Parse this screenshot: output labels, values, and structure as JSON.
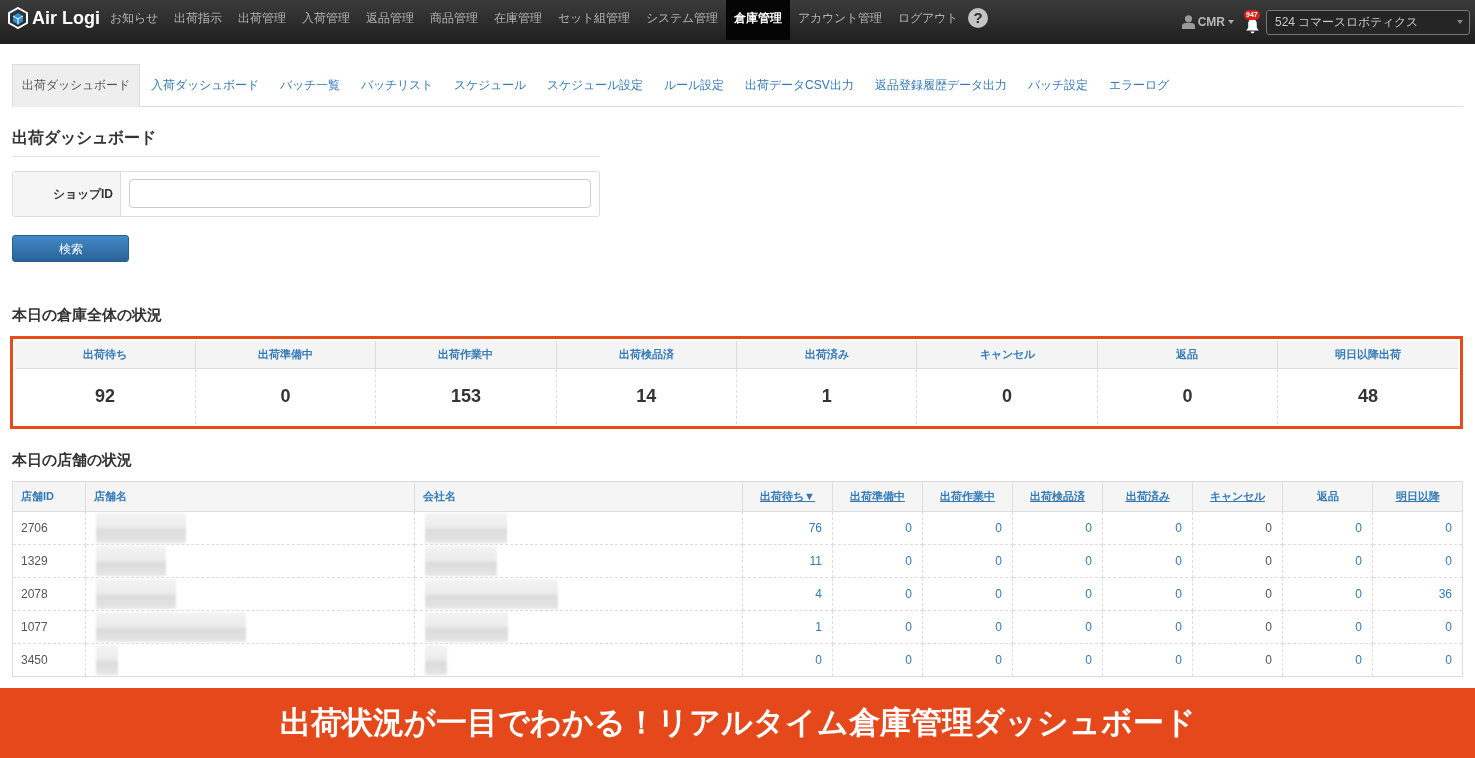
{
  "navbar": {
    "logo": "Air Logi",
    "menu": [
      {
        "label": "お知らせ",
        "selected": false
      },
      {
        "label": "出荷指示",
        "selected": false
      },
      {
        "label": "出荷管理",
        "selected": false
      },
      {
        "label": "入荷管理",
        "selected": false
      },
      {
        "label": "返品管理",
        "selected": false
      },
      {
        "label": "商品管理",
        "selected": false
      },
      {
        "label": "在庫管理",
        "selected": false
      },
      {
        "label": "セット組管理",
        "selected": false
      },
      {
        "label": "システム管理",
        "selected": false
      },
      {
        "label": "倉庫管理",
        "selected": true
      },
      {
        "label": "アカウント管理",
        "selected": false
      },
      {
        "label": "ログアウト",
        "selected": false
      }
    ],
    "help": "?",
    "user": "CMR",
    "notification_count": "947",
    "warehouse_select": "524 コマースロボティクス"
  },
  "tabs": [
    {
      "label": "出荷ダッシュボード",
      "selected": true
    },
    {
      "label": "入荷ダッシュボード",
      "selected": false
    },
    {
      "label": "バッチ一覧",
      "selected": false
    },
    {
      "label": "バッチリスト",
      "selected": false
    },
    {
      "label": "スケジュール",
      "selected": false
    },
    {
      "label": "スケジュール設定",
      "selected": false
    },
    {
      "label": "ルール設定",
      "selected": false
    },
    {
      "label": "出荷データCSV出力",
      "selected": false
    },
    {
      "label": "返品登録履歴データ出力",
      "selected": false
    },
    {
      "label": "バッチ設定",
      "selected": false
    },
    {
      "label": "エラーログ",
      "selected": false
    }
  ],
  "page_title": "出荷ダッシュボード",
  "search_form": {
    "label": "ショップID",
    "button": "検索"
  },
  "warehouse_status": {
    "title": "本日の倉庫全体の状況",
    "highlighted": true,
    "items": [
      {
        "label": "出荷待ち",
        "value": "92"
      },
      {
        "label": "出荷準備中",
        "value": "0"
      },
      {
        "label": "出荷作業中",
        "value": "153"
      },
      {
        "label": "出荷検品済",
        "value": "14"
      },
      {
        "label": "出荷済み",
        "value": "1"
      },
      {
        "label": "キャンセル",
        "value": "0"
      },
      {
        "label": "返品",
        "value": "0"
      },
      {
        "label": "明日以降出荷",
        "value": "48"
      }
    ]
  },
  "store_status": {
    "title": "本日の店舗の状況",
    "columns": [
      {
        "label": "店舗ID",
        "kind": "id",
        "sortable": false
      },
      {
        "label": "店舗名",
        "kind": "redacted",
        "sortable": false
      },
      {
        "label": "会社名",
        "kind": "redacted",
        "sortable": false
      },
      {
        "label": "出荷待ち▼",
        "kind": "link_count",
        "sortable": true
      },
      {
        "label": "出荷準備中",
        "kind": "link_count",
        "sortable": true
      },
      {
        "label": "出荷作業中",
        "kind": "link_count",
        "sortable": true
      },
      {
        "label": "出荷検品済",
        "kind": "link_count",
        "sortable": true
      },
      {
        "label": "出荷済み",
        "kind": "link_count",
        "sortable": true
      },
      {
        "label": "キャンセル",
        "kind": "count",
        "sortable": true
      },
      {
        "label": "返品",
        "kind": "link_count",
        "sortable": false
      },
      {
        "label": "明日以降",
        "kind": "link_count",
        "sortable": true
      }
    ],
    "rows": [
      {
        "id": "2706",
        "counts": [
          "76",
          "0",
          "0",
          "0",
          "0",
          "0",
          "0",
          "0"
        ]
      },
      {
        "id": "1329",
        "counts": [
          "11",
          "0",
          "0",
          "0",
          "0",
          "0",
          "0",
          "0"
        ]
      },
      {
        "id": "2078",
        "counts": [
          "4",
          "0",
          "0",
          "0",
          "0",
          "0",
          "0",
          "36"
        ]
      },
      {
        "id": "1077",
        "counts": [
          "1",
          "0",
          "0",
          "0",
          "0",
          "0",
          "0",
          "0"
        ]
      },
      {
        "id": "3450",
        "counts": [
          "0",
          "0",
          "0",
          "0",
          "0",
          "0",
          "0",
          "0"
        ]
      }
    ]
  },
  "banner": {
    "text": "出荷状況が一目でわかる！リアルタイム倉庫管理ダッシュボード"
  }
}
